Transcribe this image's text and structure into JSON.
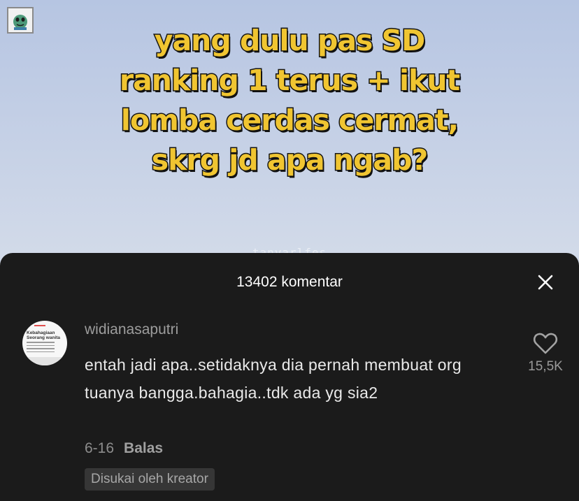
{
  "video": {
    "caption_lines": [
      "yang dulu pas SD",
      "ranking 1 terus + ikut",
      "lomba cerdas cermat,",
      "skrg jd apa ngab?"
    ],
    "watermark": "tanyarlfes",
    "caption_color": "#f0c531",
    "sticker_icon": "green-creature-sticker-icon"
  },
  "comments_panel": {
    "title": "13402 komentar",
    "close_icon": "close-icon"
  },
  "comment": {
    "avatar_text": "Kebahagiaan Seorang wanita",
    "username": "widianasaputri",
    "text": "entah jadi apa..setidaknya dia pernah membuat org tuanya bangga.bahagia..tdk ada yg sia2",
    "date": "6-16",
    "reply_label": "Balas",
    "creator_badge": "Disukai oleh kreator",
    "like_icon": "heart-outline-icon",
    "like_count": "15,5K"
  }
}
